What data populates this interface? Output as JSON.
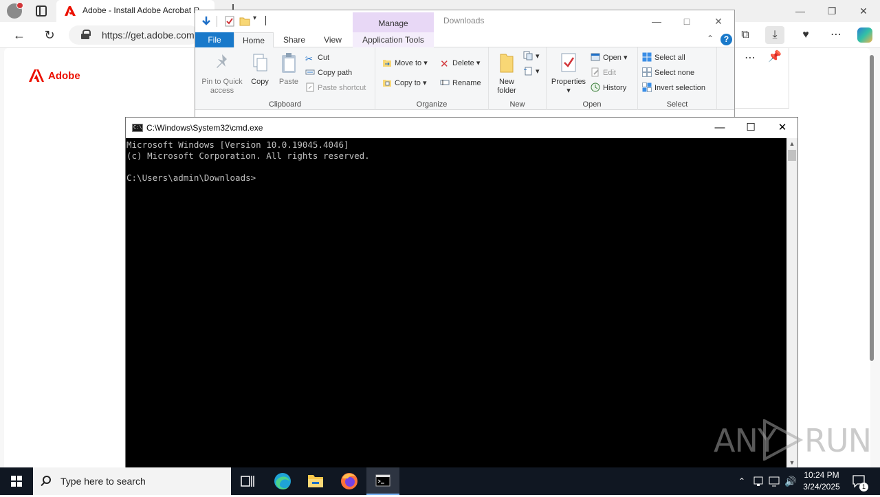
{
  "browser": {
    "tab_title": "Adobe - Install Adobe Acrobat Reader",
    "url": "https://get.adobe.com",
    "page_logo_text": "Adobe"
  },
  "explorer": {
    "manage_label": "Manage",
    "path_title": "Downloads",
    "tabs": [
      "File",
      "Home",
      "Share",
      "View",
      "Application Tools"
    ],
    "clipboard": {
      "pin": "Pin to Quick access",
      "copy": "Copy",
      "paste": "Paste",
      "cut": "Cut",
      "copy_path": "Copy path",
      "paste_shortcut": "Paste shortcut",
      "label": "Clipboard"
    },
    "organize": {
      "move_to": "Move to",
      "copy_to": "Copy to",
      "delete": "Delete",
      "rename": "Rename",
      "label": "Organize"
    },
    "new": {
      "new_folder": "New folder",
      "label": "New"
    },
    "open": {
      "properties": "Properties",
      "open": "Open",
      "edit": "Edit",
      "history": "History",
      "label": "Open"
    },
    "select": {
      "select_all": "Select all",
      "select_none": "Select none",
      "invert": "Invert selection",
      "label": "Select"
    }
  },
  "cmd": {
    "title": "C:\\Windows\\System32\\cmd.exe",
    "lines": [
      "Microsoft Windows [Version 10.0.19045.4046]",
      "(c) Microsoft Corporation. All rights reserved.",
      "",
      "C:\\Users\\admin\\Downloads>"
    ]
  },
  "taskbar": {
    "search_placeholder": "Type here to search",
    "time": "10:24 PM",
    "date": "3/24/2025",
    "notification_count": "1"
  },
  "watermark": {
    "left": "ANY",
    "right": "RUN"
  },
  "colors": {
    "adobe_red": "#eb1000",
    "file_tab_blue": "#1979ca",
    "manage_purple": "#e8d8f6",
    "taskbar": "#101722",
    "console_bg": "#000000",
    "console_fg": "#c0c0c0"
  }
}
